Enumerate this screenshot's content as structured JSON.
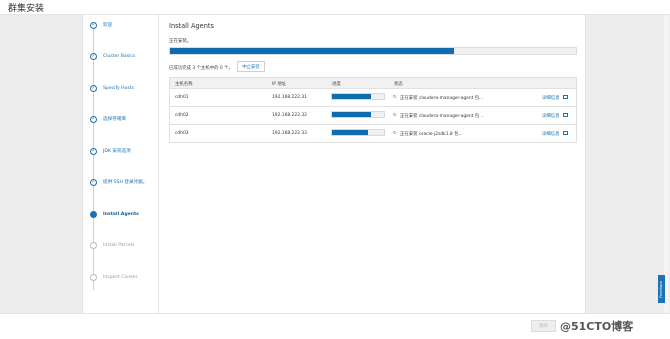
{
  "app_title": "群集安装",
  "steps": [
    {
      "label": "欢迎",
      "state": "done"
    },
    {
      "label": "Cluster Basics",
      "state": "done"
    },
    {
      "label": "Specify Hosts",
      "state": "done"
    },
    {
      "label": "选择存储库",
      "state": "done"
    },
    {
      "label": "JDK 安装选项",
      "state": "done"
    },
    {
      "label": "提供 SSH 登录凭据。",
      "state": "done"
    },
    {
      "label": "Install Agents",
      "state": "active"
    },
    {
      "label": "Install Parcels",
      "state": "pending"
    },
    {
      "label": "Inspect Cluster",
      "state": "pending"
    }
  ],
  "main": {
    "title": "Install Agents",
    "subtitle": "正在安装。",
    "overall_progress": 0.7,
    "summary": "已成功完成 3 个主机中的 0 个。",
    "abort_label": "中止安装"
  },
  "table": {
    "headers": [
      "主机名称",
      "IP 地址",
      "进度",
      "状态"
    ],
    "rows": [
      {
        "host": "cdh01",
        "ip": "192.168.222.31",
        "progress": 0.75,
        "status": "正在安装 cloudera-manager-agent 包...",
        "detail": "详细信息"
      },
      {
        "host": "cdh02",
        "ip": "192.168.222.32",
        "progress": 0.75,
        "status": "正在安装 cloudera-manager-agent 包...",
        "detail": "详细信息"
      },
      {
        "host": "cdh03",
        "ip": "192.168.222.33",
        "progress": 0.7,
        "status": "正在安装 oracle-j2sdk1.8 包...",
        "detail": "详细信息"
      }
    ]
  },
  "footer": {
    "continue_label": "继续",
    "watermark": "@51CTO博客"
  },
  "feedback_label": "Feedback",
  "colors": {
    "accent": "#0f6cad",
    "link": "#1a73b5"
  }
}
